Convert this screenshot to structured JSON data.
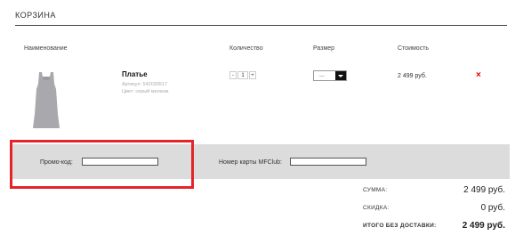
{
  "cart": {
    "title": "КОРЗИНА"
  },
  "table": {
    "headers": {
      "name": "Наименование",
      "quantity": "Количество",
      "size": "Размер",
      "cost": "Стоимость"
    }
  },
  "item": {
    "name": "Платье",
    "article": "Артикул: 542030517",
    "color": "Цвет: серый меланж",
    "quantity": {
      "minus": "-",
      "value": "1",
      "plus": "+"
    },
    "size_value": "...",
    "price": "2 499 руб.",
    "remove_icon": "×",
    "thumbnail_color": "#a8a8ad",
    "remove_color": "#e00000"
  },
  "promo": {
    "label": "Промо-код:",
    "value": "",
    "card_label": "Номер карты MFClub:",
    "card_value": "",
    "highlight_color": "#e3252b",
    "band_color": "#dcdcdc"
  },
  "summary": {
    "sum_label": "СУММА:",
    "sum_value": "2 499 руб.",
    "discount_label": "СКИДКА:",
    "discount_value": "0 руб.",
    "total_label": "ИТОГО БЕЗ ДОСТАВКИ:",
    "total_value": "2 499 руб."
  }
}
